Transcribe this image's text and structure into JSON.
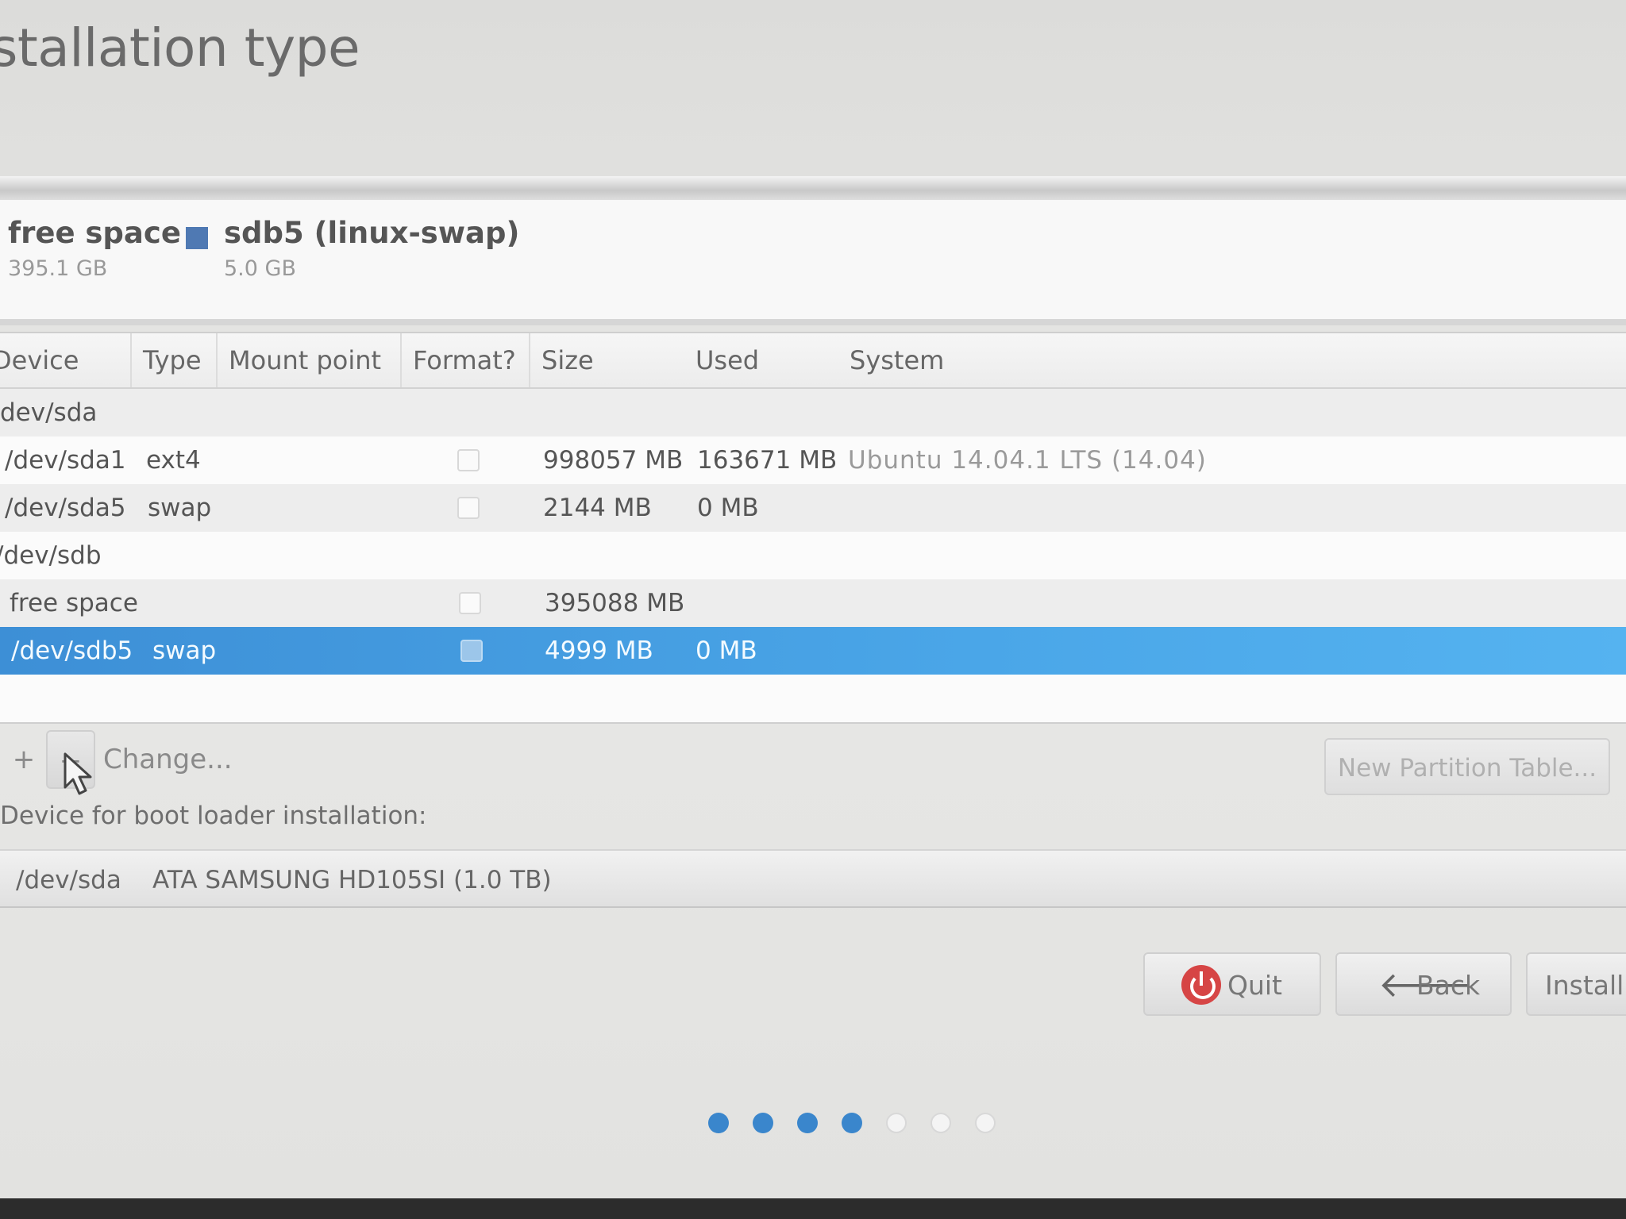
{
  "page": {
    "title": "stallation type"
  },
  "legend": [
    {
      "name": "free space",
      "size": "395.1 GB"
    },
    {
      "name": "sdb5 (linux-swap)",
      "size": "5.0 GB",
      "color": "#4f79b3"
    }
  ],
  "table": {
    "columns": [
      "Device",
      "Type",
      "Mount point",
      "Format?",
      "Size",
      "Used",
      "System"
    ],
    "rows": [
      {
        "device": "dev/sda",
        "type": "",
        "mount": "",
        "size": "",
        "used": "",
        "system": "",
        "header": true
      },
      {
        "device": "/dev/sda1",
        "type": "ext4",
        "mount": "",
        "size": "998057 MB",
        "used": "163671 MB",
        "system": "Ubuntu 14.04.1 LTS (14.04)",
        "format_checked": false
      },
      {
        "device": "/dev/sda5",
        "type": "swap",
        "mount": "",
        "size": "2144 MB",
        "used": "0 MB",
        "system": "",
        "format_checked": false
      },
      {
        "device": "/dev/sdb",
        "type": "",
        "mount": "",
        "size": "",
        "used": "",
        "system": "",
        "header": true
      },
      {
        "device": "free space",
        "type": "",
        "mount": "",
        "size": "395088 MB",
        "used": "",
        "system": "",
        "format_checked": false
      },
      {
        "device": "/dev/sdb5",
        "type": "swap",
        "mount": "",
        "size": "4999 MB",
        "used": "0 MB",
        "system": "",
        "format_checked": false,
        "selected": true
      }
    ]
  },
  "toolbar": {
    "add_label": "+",
    "remove_label": "−",
    "change_label": "Change...",
    "new_table_label": "New Partition Table..."
  },
  "bootloader": {
    "label": "Device for boot loader installation:",
    "device": "/dev/sda",
    "description": "ATA SAMSUNG HD105SI (1.0 TB)"
  },
  "nav": {
    "quit_label": "Quit",
    "back_label": "Back",
    "install_label": "Install"
  },
  "progress": {
    "total_steps": 7,
    "completed_steps": 4
  },
  "colors": {
    "selection": "#4aa6e8",
    "quit_icon": "#d64545",
    "dot_active": "#3a86cc"
  }
}
